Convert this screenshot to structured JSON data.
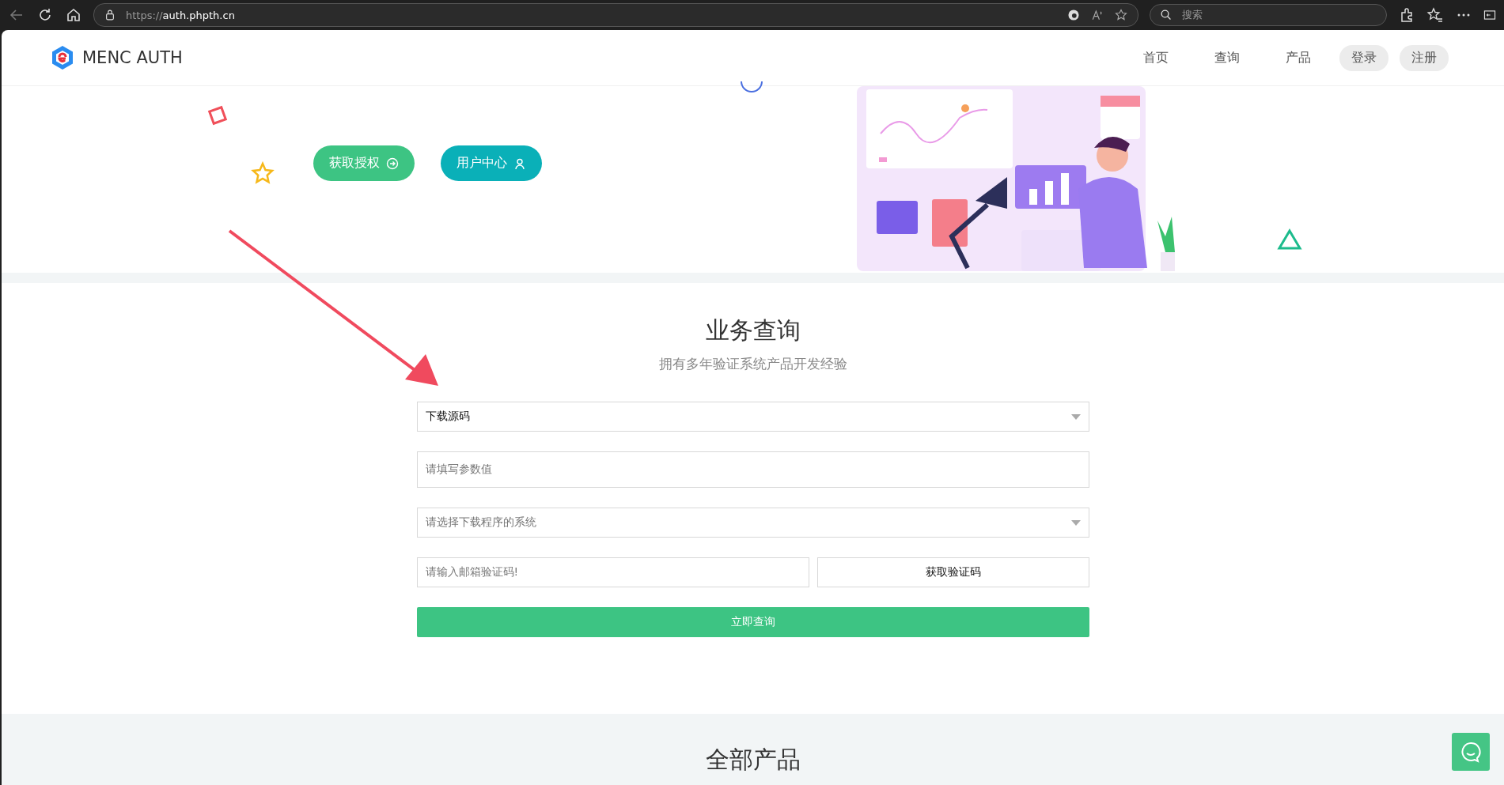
{
  "browser": {
    "url_scheme": "https://",
    "url_host": "auth.phpth.cn",
    "search": {
      "placeholder": "搜索"
    }
  },
  "header": {
    "logo": "MENC AUTH",
    "nav": [
      {
        "label": "首页",
        "kind": "link"
      },
      {
        "label": "查询",
        "kind": "link"
      },
      {
        "label": "产品",
        "kind": "link"
      },
      {
        "label": "登录",
        "kind": "pill"
      },
      {
        "label": "注册",
        "kind": "pill"
      }
    ]
  },
  "hero": {
    "buttons": [
      {
        "label": "获取授权",
        "kind": "auth"
      },
      {
        "label": "用户中心",
        "kind": "user"
      }
    ]
  },
  "query": {
    "title": "业务查询",
    "subtitle": "拥有多年验证系统产品开发经验",
    "fields": [
      {
        "kind": "select",
        "value": "下载源码"
      },
      {
        "kind": "text",
        "placeholder": "请填写参数值"
      },
      {
        "kind": "select",
        "placeholder": "请选择下载程序的系统"
      },
      {
        "kind": "code",
        "placeholder": "请输入邮箱验证码!",
        "button": "获取验证码"
      }
    ],
    "submit": "立即查询"
  },
  "products": {
    "title": "全部产品"
  }
}
